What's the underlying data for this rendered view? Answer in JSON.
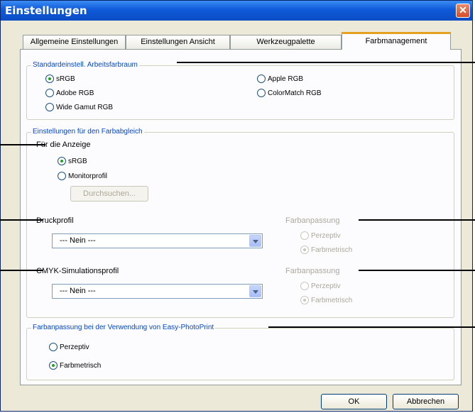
{
  "window": {
    "title": "Einstellungen",
    "close_glyph": "✕"
  },
  "tabs": [
    {
      "label": "Allgemeine Einstellungen"
    },
    {
      "label": "Einstellungen Ansicht"
    },
    {
      "label": "Werkzeugpalette"
    },
    {
      "label": "Farbmanagement",
      "active": true
    }
  ],
  "workspace": {
    "legend": "Standardeinstell. Arbeitsfarbraum",
    "options": [
      {
        "label": "sRGB",
        "selected": true
      },
      {
        "label": "Adobe RGB",
        "selected": false
      },
      {
        "label": "Wide Gamut RGB",
        "selected": false
      },
      {
        "label": "Apple RGB",
        "selected": false
      },
      {
        "label": "ColorMatch RGB",
        "selected": false
      }
    ]
  },
  "matching": {
    "legend": "Einstellungen für den Farbabgleich",
    "display": {
      "label": "Für die Anzeige",
      "options": [
        {
          "label": "sRGB",
          "selected": true
        },
        {
          "label": "Monitorprofil",
          "selected": false
        }
      ],
      "browse_label": "Durchsuchen..."
    },
    "print": {
      "label": "Druckprofil",
      "select_value": "--- Nein ---",
      "intent_label": "Farbanpassung",
      "intent_options": [
        {
          "label": "Perzeptiv",
          "selected": false
        },
        {
          "label": "Farbmetrisch",
          "selected": true
        }
      ]
    },
    "cmyk": {
      "label": "CMYK-Simulationsprofil",
      "select_value": "--- Nein ---",
      "intent_label": "Farbanpassung",
      "intent_options": [
        {
          "label": "Perzeptiv",
          "selected": false
        },
        {
          "label": "Farbmetrisch",
          "selected": true
        }
      ]
    }
  },
  "easy_photoprint": {
    "legend": "Farbanpassung bei der Verwendung von Easy-PhotoPrint",
    "options": [
      {
        "label": "Perzeptiv",
        "selected": false
      },
      {
        "label": "Farbmetrisch",
        "selected": true
      }
    ]
  },
  "footer": {
    "ok_label": "OK",
    "cancel_label": "Abbrechen"
  },
  "colors": {
    "title_bar": "#0f5ad9",
    "legend_text": "#0046d5",
    "active_tab_accent": "#e6a121",
    "radio_dot": "#21a121"
  }
}
